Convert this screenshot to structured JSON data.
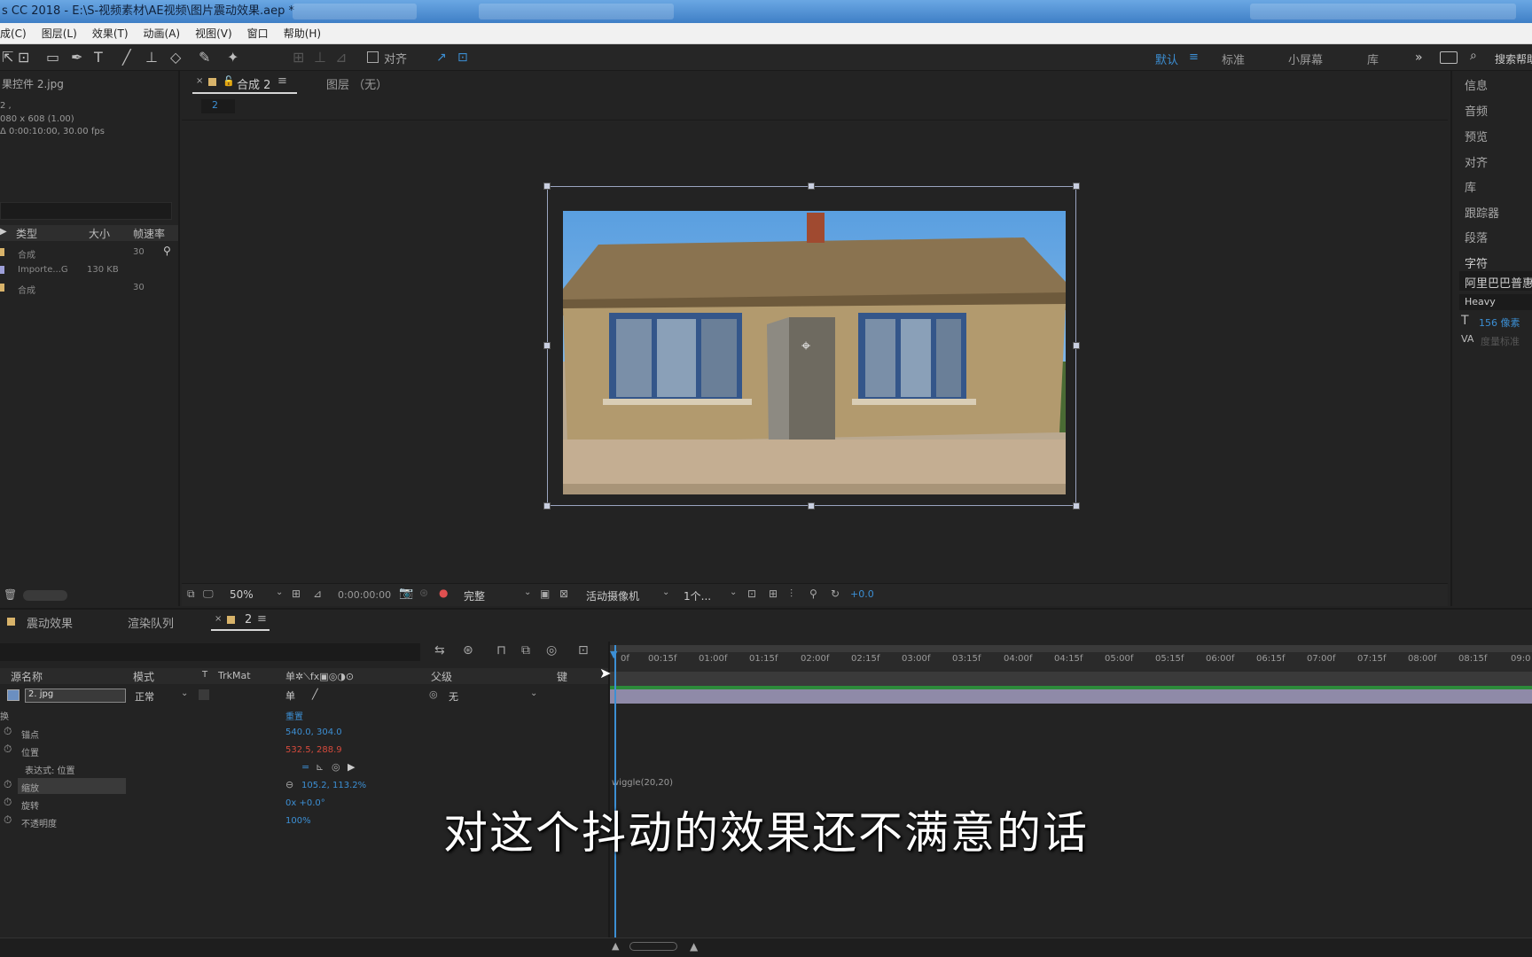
{
  "window": {
    "title": "s CC 2018 - E:\\S-视频素材\\AE视频\\图片震动效果.aep *"
  },
  "menu": [
    "成(C)",
    "图层(L)",
    "效果(T)",
    "动画(A)",
    "视图(V)",
    "窗口",
    "帮助(H)"
  ],
  "toolbar": {
    "align_label": "对齐",
    "workspaces": [
      "默认",
      "标准",
      "小屏幕",
      "库"
    ],
    "search_placeholder": "搜索帮助"
  },
  "project": {
    "tab_title": "果控件 2.jpg",
    "info_line1": "2 ,",
    "info_line2": "080 x 608 (1.00)",
    "info_line3": "Δ 0:00:10:00, 30.00 fps",
    "columns": [
      "类型",
      "大小",
      "帧速率"
    ],
    "items": [
      {
        "type": "合成",
        "size": "",
        "fps": "30"
      },
      {
        "type": "Importe...G",
        "size": "130 KB",
        "fps": ""
      },
      {
        "type": "合成",
        "size": "",
        "fps": "30"
      }
    ]
  },
  "composition": {
    "tab_label": "合成 2",
    "layer_tab": "图层 （无）",
    "breadcrumb": "2"
  },
  "viewer_controls": {
    "zoom": "50%",
    "timecode": "0:00:00:00",
    "resolution": "完整",
    "camera": "活动摄像机",
    "views": "1个...",
    "exposure": "+0.0"
  },
  "right_panel": {
    "items": [
      "信息",
      "音频",
      "预览",
      "对齐",
      "库",
      "跟踪器",
      "段落",
      "字符"
    ],
    "font_name": "阿里巴巴普惠",
    "font_style": "Heavy",
    "font_size": "156 像素",
    "tracking_label": "度量标准"
  },
  "timeline": {
    "tabs": [
      "震动效果",
      "渲染队列",
      "2"
    ],
    "columns": {
      "source": "源名称",
      "mode": "模式",
      "t": "T",
      "trkmat": "TrkMat",
      "parent": "父级",
      "key": "键"
    },
    "layer": {
      "name": "2. jpg",
      "mode": "正常",
      "parent": "无"
    },
    "transform_label": "换",
    "reset_label": "重置",
    "properties": [
      {
        "name": "锚点",
        "value": "540.0, 304.0"
      },
      {
        "name": "位置",
        "value": "532.5, 288.9"
      },
      {
        "name": "表达式: 位置",
        "value": ""
      },
      {
        "name": "缩放",
        "value": "105.2, 113.2%"
      },
      {
        "name": "旋转",
        "value": "0x +0.0°"
      },
      {
        "name": "不透明度",
        "value": "100%"
      }
    ],
    "expression": "wiggle(20,20)",
    "ruler": [
      "0f",
      "00:15f",
      "01:00f",
      "01:15f",
      "02:00f",
      "02:15f",
      "03:00f",
      "03:15f",
      "04:00f",
      "04:15f",
      "05:00f",
      "05:15f",
      "06:00f",
      "06:15f",
      "07:00f",
      "07:15f",
      "08:00f",
      "08:15f",
      "09:0"
    ]
  },
  "subtitle": "对这个抖动的效果还不满意的话",
  "colors": {
    "accent": "#3c8fd4",
    "position_value": "#d44a3c",
    "layer_bar": "#8f8aa8"
  }
}
